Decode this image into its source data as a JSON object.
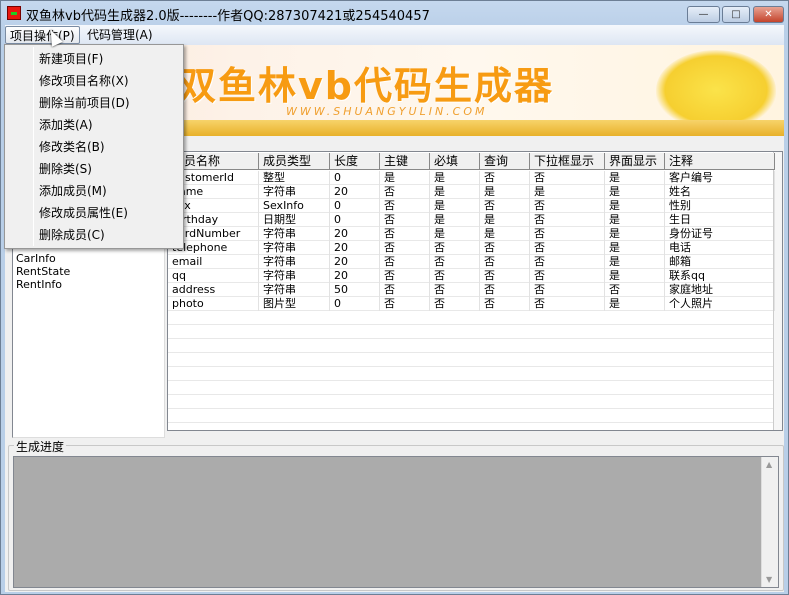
{
  "window": {
    "title": "双鱼林vb代码生成器2.0版--------作者QQ:287307421或254540457",
    "minimize": "—",
    "maximize": "□",
    "close": "✕"
  },
  "menubar": [
    {
      "label": "项目操作(P)"
    },
    {
      "label": "代码管理(A)"
    }
  ],
  "banner": {
    "logo": "双鱼林vb代码生成器",
    "url": "WWW.SHUANGYULIN.COM"
  },
  "dropdown": [
    "新建项目(F)",
    "修改项目名称(X)",
    "删除当前项目(D)",
    "添加类(A)",
    "修改类名(B)",
    "删除类(S)",
    "添加成员(M)",
    "修改成员属性(E)",
    "删除成员(C)"
  ],
  "class_list": [
    "CarInfo",
    "RentState",
    "RentInfo"
  ],
  "grid": {
    "columns": [
      "成员名称",
      "成员类型",
      "长度",
      "主键",
      "必填",
      "查询",
      "下拉框显示",
      "界面显示",
      "注释"
    ],
    "rows": [
      [
        "customerId",
        "整型",
        "0",
        "是",
        "是",
        "否",
        "否",
        "是",
        "客户编号"
      ],
      [
        "name",
        "字符串",
        "20",
        "否",
        "是",
        "是",
        "是",
        "是",
        "姓名"
      ],
      [
        "sex",
        "SexInfo",
        "0",
        "否",
        "是",
        "否",
        "否",
        "是",
        "性别"
      ],
      [
        "birthday",
        "日期型",
        "0",
        "否",
        "是",
        "是",
        "否",
        "是",
        "生日"
      ],
      [
        "cardNumber",
        "字符串",
        "20",
        "否",
        "是",
        "是",
        "否",
        "是",
        "身份证号"
      ],
      [
        "telephone",
        "字符串",
        "20",
        "否",
        "否",
        "否",
        "否",
        "是",
        "电话"
      ],
      [
        "email",
        "字符串",
        "20",
        "否",
        "否",
        "否",
        "否",
        "是",
        "邮箱"
      ],
      [
        "qq",
        "字符串",
        "20",
        "否",
        "否",
        "否",
        "否",
        "是",
        "联系qq"
      ],
      [
        "address",
        "字符串",
        "50",
        "否",
        "否",
        "否",
        "否",
        "否",
        "家庭地址"
      ],
      [
        "photo",
        "图片型",
        "0",
        "否",
        "否",
        "否",
        "否",
        "是",
        "个人照片"
      ]
    ]
  },
  "progress": {
    "label": "生成进度"
  }
}
